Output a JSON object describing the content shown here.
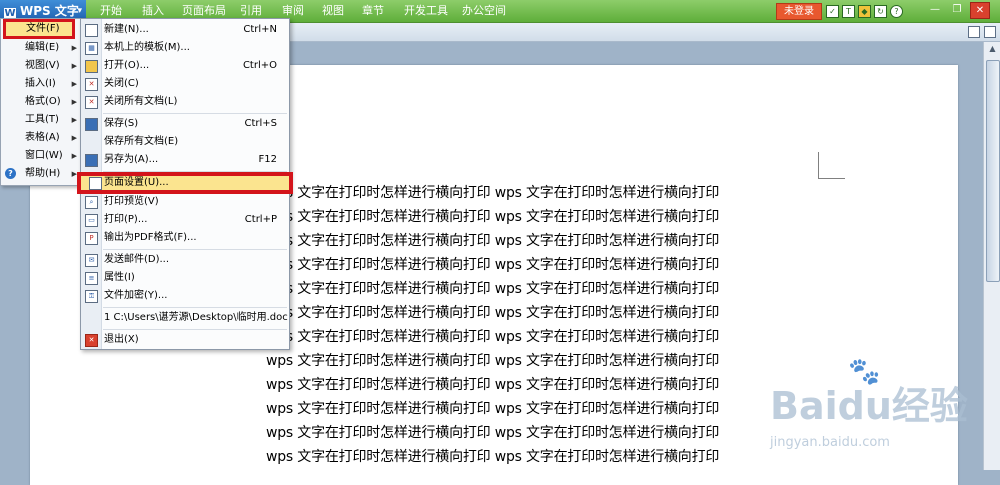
{
  "app": {
    "name": "WPS 文字",
    "logo": "W"
  },
  "tabs": [
    "开始",
    "插入",
    "页面布局",
    "引用",
    "审阅",
    "视图",
    "章节",
    "开发工具",
    "办公空间"
  ],
  "login_label": "未登录",
  "top_icons": [
    "checkbox-icon",
    "shirt-icon",
    "shield-icon",
    "refresh-icon",
    "help-icon"
  ],
  "main_menu": [
    {
      "label": "文件(F)",
      "submenu": true
    },
    {
      "label": "编辑(E)",
      "submenu": true
    },
    {
      "label": "视图(V)",
      "submenu": true
    },
    {
      "label": "插入(I)",
      "submenu": true
    },
    {
      "label": "格式(O)",
      "submenu": true
    },
    {
      "label": "工具(T)",
      "submenu": true
    },
    {
      "label": "表格(A)",
      "submenu": true
    },
    {
      "label": "窗口(W)",
      "submenu": true
    },
    {
      "label": "帮助(H)",
      "submenu": true
    }
  ],
  "file_menu": {
    "new": {
      "label": "新建(N)...",
      "shortcut": "Ctrl+N"
    },
    "local_templates": {
      "label": "本机上的模板(M)..."
    },
    "open": {
      "label": "打开(O)...",
      "shortcut": "Ctrl+O"
    },
    "close": {
      "label": "关闭(C)"
    },
    "close_all": {
      "label": "关闭所有文档(L)"
    },
    "save": {
      "label": "保存(S)",
      "shortcut": "Ctrl+S"
    },
    "save_all": {
      "label": "保存所有文档(E)"
    },
    "save_as": {
      "label": "另存为(A)...",
      "shortcut": "F12"
    },
    "page_setup": {
      "label": "页面设置(U)..."
    },
    "print_preview": {
      "label": "打印预览(V)"
    },
    "print": {
      "label": "打印(P)...",
      "shortcut": "Ctrl+P"
    },
    "export_pdf": {
      "label": "输出为PDF格式(F)..."
    },
    "send_mail": {
      "label": "发送邮件(D)..."
    },
    "properties": {
      "label": "属性(I)"
    },
    "encrypt": {
      "label": "文件加密(Y)..."
    },
    "recent": {
      "label": "1 C:\\Users\\谌芳源\\Desktop\\临时用.doc"
    },
    "exit": {
      "label": "退出(X)"
    }
  },
  "document": {
    "lines": [
      "wps 文字在打印时怎样进行横向打印 wps 文字在打印时怎样进行横向打印",
      "wps 文字在打印时怎样进行横向打印 wps 文字在打印时怎样进行横向打印",
      "wps 文字在打印时怎样进行横向打印 wps 文字在打印时怎样进行横向打印",
      "wps 文字在打印时怎样进行横向打印 wps 文字在打印时怎样进行横向打印",
      "wps 文字在打印时怎样进行横向打印 wps 文字在打印时怎样进行横向打印",
      "wps 文字在打印时怎样进行横向打印 wps 文字在打印时怎样进行横向打印",
      "wps 文字在打印时怎样进行横向打印 wps 文字在打印时怎样进行横向打印",
      "wps 文字在打印时怎样进行横向打印 wps 文字在打印时怎样进行横向打印",
      "wps 文字在打印时怎样进行横向打印 wps 文字在打印时怎样进行横向打印",
      "wps 文字在打印时怎样进行横向打印 wps 文字在打印时怎样进行横向打印",
      "wps 文字在打印时怎样进行横向打印 wps 文字在打印时怎样进行横向打印",
      "wps 文字在打印时怎样进行横向打印 wps 文字在打印时怎样进行横向打印",
      "wps 文字在打印时怎样进行横向打印 wps 文字在打印时怎样进行横向打印"
    ]
  },
  "watermark": {
    "brand": "Baidu经验",
    "url": "jingyan.baidu.com"
  },
  "colors": {
    "ribbon": "#5fae3a",
    "highlight": "#fbe48f",
    "annotation": "#d3141b",
    "login": "#e8582f"
  }
}
